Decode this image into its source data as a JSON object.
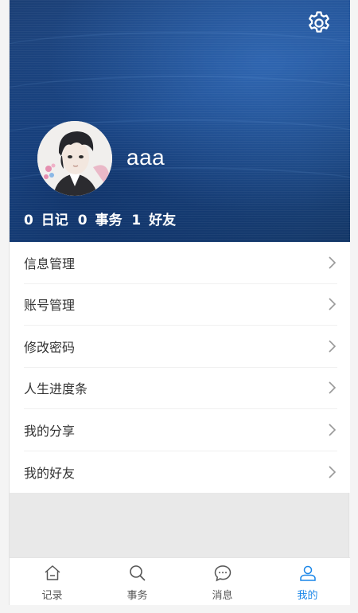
{
  "profile": {
    "username": "aaa",
    "stats": {
      "diary_count": "0",
      "diary_label": "日记",
      "task_count": "0",
      "task_label": "事务",
      "friend_count": "1",
      "friend_label": "好友"
    }
  },
  "menu": {
    "items": [
      {
        "label": "信息管理"
      },
      {
        "label": "账号管理"
      },
      {
        "label": "修改密码"
      },
      {
        "label": "人生进度条"
      },
      {
        "label": "我的分享"
      },
      {
        "label": "我的好友"
      }
    ]
  },
  "tabbar": {
    "items": [
      {
        "label": "记录",
        "icon": "home-icon"
      },
      {
        "label": "事务",
        "icon": "search-icon"
      },
      {
        "label": "消息",
        "icon": "chat-icon"
      },
      {
        "label": "我的",
        "icon": "user-icon"
      }
    ],
    "active_index": 3
  },
  "colors": {
    "accent": "#1a86e8",
    "header": "#1f4f93",
    "text": "#333333",
    "chevron": "#999999"
  }
}
